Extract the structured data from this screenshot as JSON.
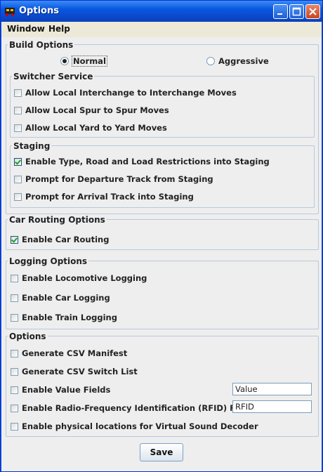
{
  "window": {
    "title": "Options"
  },
  "menu": [
    "Window",
    "Help"
  ],
  "build_options": {
    "label": "Build Options",
    "radios": [
      {
        "label": "Normal",
        "selected": true
      },
      {
        "label": "Aggressive",
        "selected": false
      }
    ],
    "switcher": {
      "label": "Switcher Service",
      "items": [
        {
          "label": "Allow Local Interchange to Interchange Moves",
          "checked": false
        },
        {
          "label": "Allow Local Spur to Spur Moves",
          "checked": false
        },
        {
          "label": "Allow Local Yard to Yard Moves",
          "checked": false
        }
      ]
    },
    "staging": {
      "label": "Staging",
      "items": [
        {
          "label": "Enable Type, Road and Load Restrictions into Staging",
          "checked": true
        },
        {
          "label": "Prompt for Departure Track from Staging",
          "checked": false
        },
        {
          "label": "Prompt for Arrival Track into Staging",
          "checked": false
        }
      ]
    }
  },
  "car_routing": {
    "label": "Car Routing Options",
    "items": [
      {
        "label": "Enable Car Routing",
        "checked": true
      }
    ]
  },
  "logging": {
    "label": "Logging Options",
    "items": [
      {
        "label": "Enable Locomotive Logging",
        "checked": false
      },
      {
        "label": "Enable Car Logging",
        "checked": false
      },
      {
        "label": "Enable Train Logging",
        "checked": false
      }
    ]
  },
  "options": {
    "label": "Options",
    "items": [
      {
        "label": "Generate CSV Manifest",
        "checked": false
      },
      {
        "label": "Generate CSV Switch List",
        "checked": false
      },
      {
        "label": "Enable Value Fields",
        "checked": false
      },
      {
        "label": "Enable Radio-Frequency Identification (RFID) Fields",
        "checked": false
      },
      {
        "label": "Enable physical locations for Virtual Sound Decoder",
        "checked": false
      }
    ],
    "value_field": "Value",
    "rfid_field": "RFID"
  },
  "save_label": "Save"
}
